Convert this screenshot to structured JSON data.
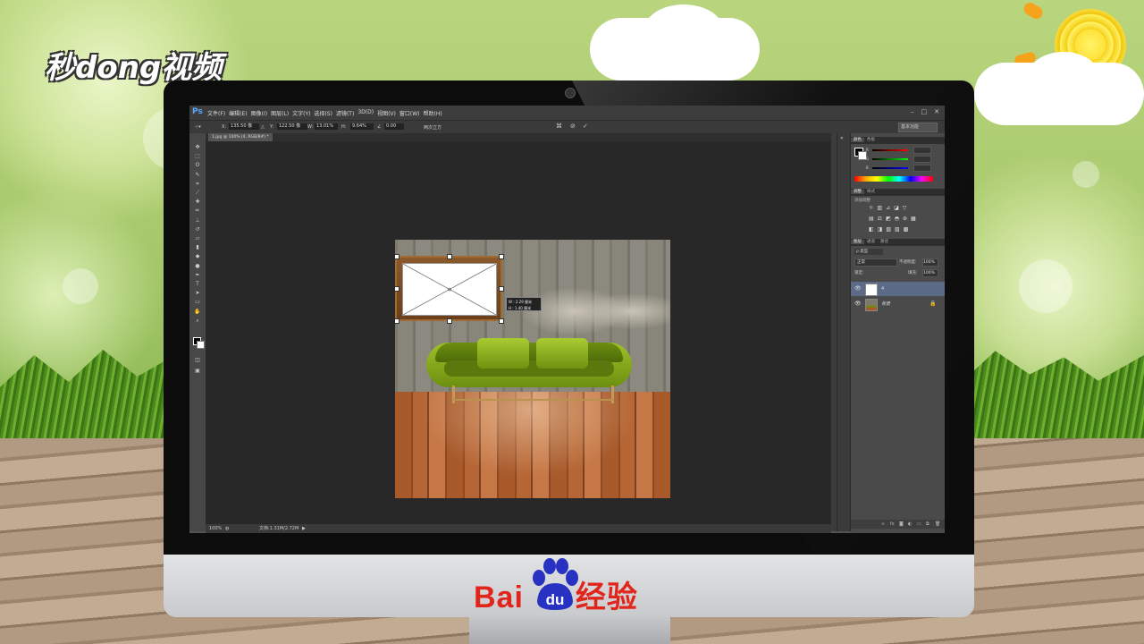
{
  "brand": {
    "top_logo": "秒dong视频",
    "bottom_logo_prefix": "Bai",
    "bottom_logo_paw": "du",
    "bottom_logo_suffix": "经验"
  },
  "photoshop": {
    "app_logo": "Ps",
    "menus": [
      "文件(F)",
      "编辑(E)",
      "图像(I)",
      "图层(L)",
      "文字(Y)",
      "选择(S)",
      "滤镜(T)",
      "3D(D)",
      "视图(V)",
      "窗口(W)",
      "帮助(H)"
    ],
    "window_controls": [
      "–",
      "□",
      "✕"
    ],
    "options": {
      "x": "135.50 像",
      "y": "122.50 像",
      "w": "13.01%",
      "h": "9.64%",
      "angle": "0.00",
      "interp": "两次立方",
      "workspace": "基本功能"
    },
    "doc_tab": "1.jpg @ 100% (4, RGB/8#) *",
    "transform_tooltip": {
      "w": "W : 2.29 厘米",
      "h": "H : 1.40 厘米"
    },
    "status": {
      "zoom": "100%",
      "doc_size": "文档:1.31M/2.72M"
    },
    "panels": {
      "color_tabs": [
        "颜色",
        "色板"
      ],
      "adjust_tabs": [
        "调整",
        "样式"
      ],
      "adjust_label": "添加调整",
      "layer_tabs": [
        "图层",
        "通道",
        "路径"
      ],
      "kind_label": "ρ 类型",
      "blend_mode": "正常",
      "opacity_label": "不透明度:",
      "opacity": "100%",
      "lock_label": "锁定:",
      "fill_label": "填充:",
      "fill": "100%",
      "layers": [
        {
          "name": "4",
          "selected": true
        },
        {
          "name": "背景",
          "selected": false,
          "locked": true
        }
      ]
    }
  },
  "colors": {
    "accent_red": "#e1251b",
    "paw_blue": "#2832c2",
    "ps_blue": "#5ba6ff",
    "layer_selected": "#5a6a87"
  }
}
